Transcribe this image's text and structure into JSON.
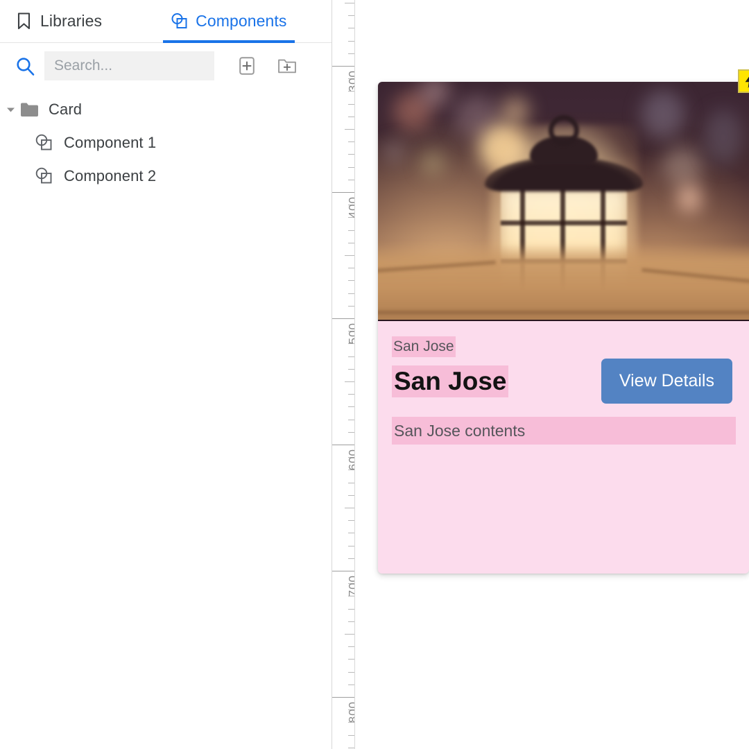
{
  "panel": {
    "tabs": [
      {
        "label": "Libraries",
        "icon": "bookmark-icon",
        "active": false
      },
      {
        "label": "Components",
        "icon": "component-icon",
        "active": true
      }
    ],
    "search": {
      "placeholder": "Search...",
      "value": "",
      "icon": "search-icon"
    },
    "actions": [
      {
        "name": "add-component-button",
        "icon": "add-component-icon"
      },
      {
        "name": "add-folder-button",
        "icon": "add-folder-icon"
      }
    ],
    "tree": [
      {
        "label": "Card",
        "icon": "folder-icon",
        "depth": 0,
        "expanded": true
      },
      {
        "label": "Component 1",
        "icon": "component-icon",
        "depth": 1
      },
      {
        "label": "Component 2",
        "icon": "component-icon",
        "depth": 1
      }
    ]
  },
  "ruler": {
    "orientation": "vertical",
    "labels": [
      "300",
      "400",
      "500",
      "600",
      "700",
      "800"
    ],
    "unit": "px"
  },
  "card": {
    "media": {
      "alt": "blurred photo of a glowing lantern on a wooden table with bokeh lights"
    },
    "badge": {
      "icon": "lightning-bolt-icon",
      "color": "#ffe500"
    },
    "subtitle": "San Jose",
    "title": "San Jose",
    "contents": "San Jose contents",
    "button": {
      "label": "View Details",
      "color": "#5383c3"
    },
    "colors": {
      "background": "#fcdced",
      "highlight": "#f7bdd8",
      "accent": "#1a73e8"
    }
  }
}
